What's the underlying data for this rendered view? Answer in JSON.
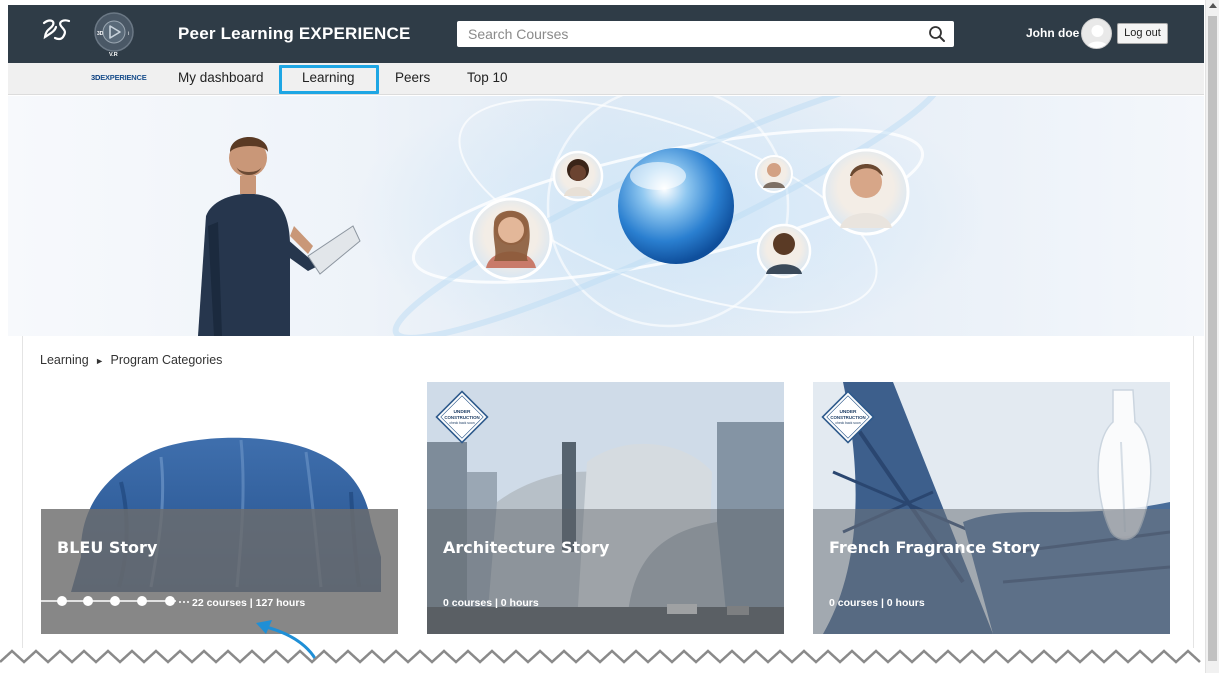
{
  "header": {
    "title": "Peer Learning EXPERIENCE",
    "search_placeholder": "Search Courses",
    "user_name": "John doe",
    "logout_label": "Log out",
    "compass_label": "V.R",
    "compass_3d": "3D",
    "compass_i": "i"
  },
  "nav": {
    "brand_3d": "3D",
    "brand_rest": "EXPERIENCE",
    "items": [
      {
        "label": "My dashboard"
      },
      {
        "label": "Learning"
      },
      {
        "label": "Peers"
      },
      {
        "label": "Top 10"
      }
    ],
    "active": "Learning"
  },
  "breadcrumb": {
    "root": "Learning",
    "separator": "►",
    "current": "Program Categories"
  },
  "cards": [
    {
      "title": "BLEU Story",
      "meta": "22 courses | 127 hours",
      "under_construction": false
    },
    {
      "title": "Architecture Story",
      "meta": "0 courses | 0 hours",
      "under_construction": true
    },
    {
      "title": "French Fragrance Story",
      "meta": "0 courses | 0 hours",
      "under_construction": true
    }
  ],
  "badge": {
    "line1": "UNDER",
    "line2": "CONSTRUCTION",
    "line3": "check back soon"
  },
  "colors": {
    "header_bg": "#2f3c47",
    "nav_bg": "#f0f0f0",
    "highlight": "#1ea6e4",
    "card_overlay": "#6c6c6c"
  }
}
